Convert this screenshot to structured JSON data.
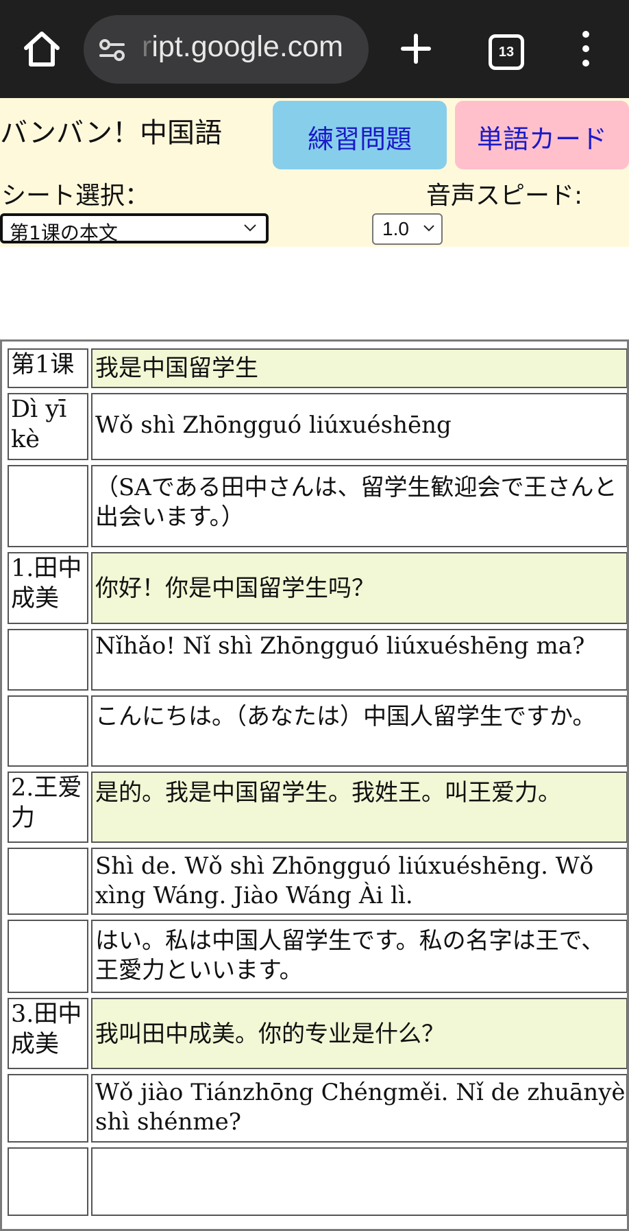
{
  "browser": {
    "url_prefix": "r",
    "url": "ipt.google.com",
    "tab_count": "13"
  },
  "header": {
    "title": "バンバン！中国語",
    "practice_button": "練習問題",
    "card_button": "単語カード",
    "sheet_label": "シート選択：",
    "speed_label": "音声スピード:",
    "sheet_value": "第1课の本文",
    "speed_value": "1.0"
  },
  "colors": {
    "header_bg": "#fff9dc",
    "practice_bg": "#87ceeb",
    "card_bg": "#ffc0cb",
    "highlight_row": "#f2f7d5",
    "link_text": "#1a1ac8"
  },
  "lesson": {
    "rows": [
      {
        "label": "第1课",
        "text": "我是中国留学生"
      },
      {
        "label": "Dì yī kè",
        "text": "Wǒ shì Zhōngguó liúxuéshēng"
      },
      {
        "label": "",
        "text": "（SAである田中さんは、留学生歓迎会で王さんと出会います。）"
      },
      {
        "label": "1.田中成美",
        "text": "你好！你是中国留学生吗？"
      },
      {
        "label": "",
        "text": "Nǐhǎo! Nǐ shì Zhōngguó liúxuéshēng ma?"
      },
      {
        "label": "",
        "text": "こんにちは。（あなたは）中国人留学生ですか。"
      },
      {
        "label": "2.王爱力",
        "text": "是的。我是中国留学生。我姓王。叫王爱力。"
      },
      {
        "label": "",
        "text": "Shì de. Wǒ shì Zhōngguó liúxuéshēng. Wǒ xìng Wáng. Jiào Wáng Ài lì."
      },
      {
        "label": "",
        "text": "はい。私は中国人留学生です。私の名字は王で、王愛力といいます。"
      },
      {
        "label": "3.田中成美",
        "text": "我叫田中成美。你的专业是什么？"
      },
      {
        "label": "",
        "text": "Wǒ jiào Tiánzhōng Chéngměi. Nǐ de zhuānyè shì shénme?"
      }
    ]
  }
}
